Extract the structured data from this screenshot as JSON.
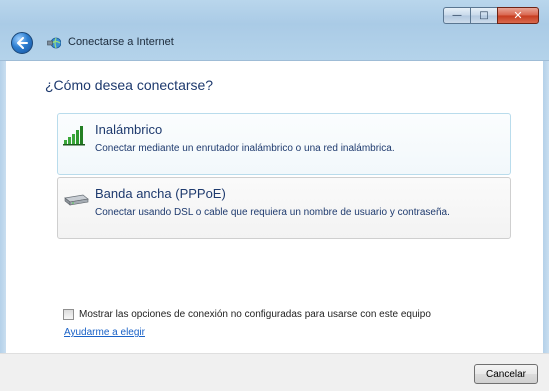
{
  "window": {
    "title": "Conectarse a Internet",
    "controls": {
      "minimize_icon": "minimize-icon",
      "maximize_icon": "maximize-icon",
      "close_icon": "close-icon"
    }
  },
  "main": {
    "heading": "¿Cómo desea conectarse?",
    "options": [
      {
        "title": "Inalámbrico",
        "description": "Conectar mediante un enrutador inalámbrico o una red inalámbrica.",
        "icon": "wireless-signal-icon"
      },
      {
        "title": "Banda ancha (PPPoE)",
        "description": "Conectar usando DSL o cable que requiera un nombre de usuario y contraseña.",
        "icon": "broadband-modem-icon"
      }
    ],
    "checkbox_label": "Mostrar las opciones de conexión no configuradas para usarse con este equipo",
    "help_link": "Ayudarme a elegir"
  },
  "footer": {
    "cancel_label": "Cancelar"
  },
  "colors": {
    "heading": "#1e3a6e",
    "link": "#1a62c7",
    "titlebar": "#b4d3ea",
    "footer": "#f0f0f0"
  }
}
